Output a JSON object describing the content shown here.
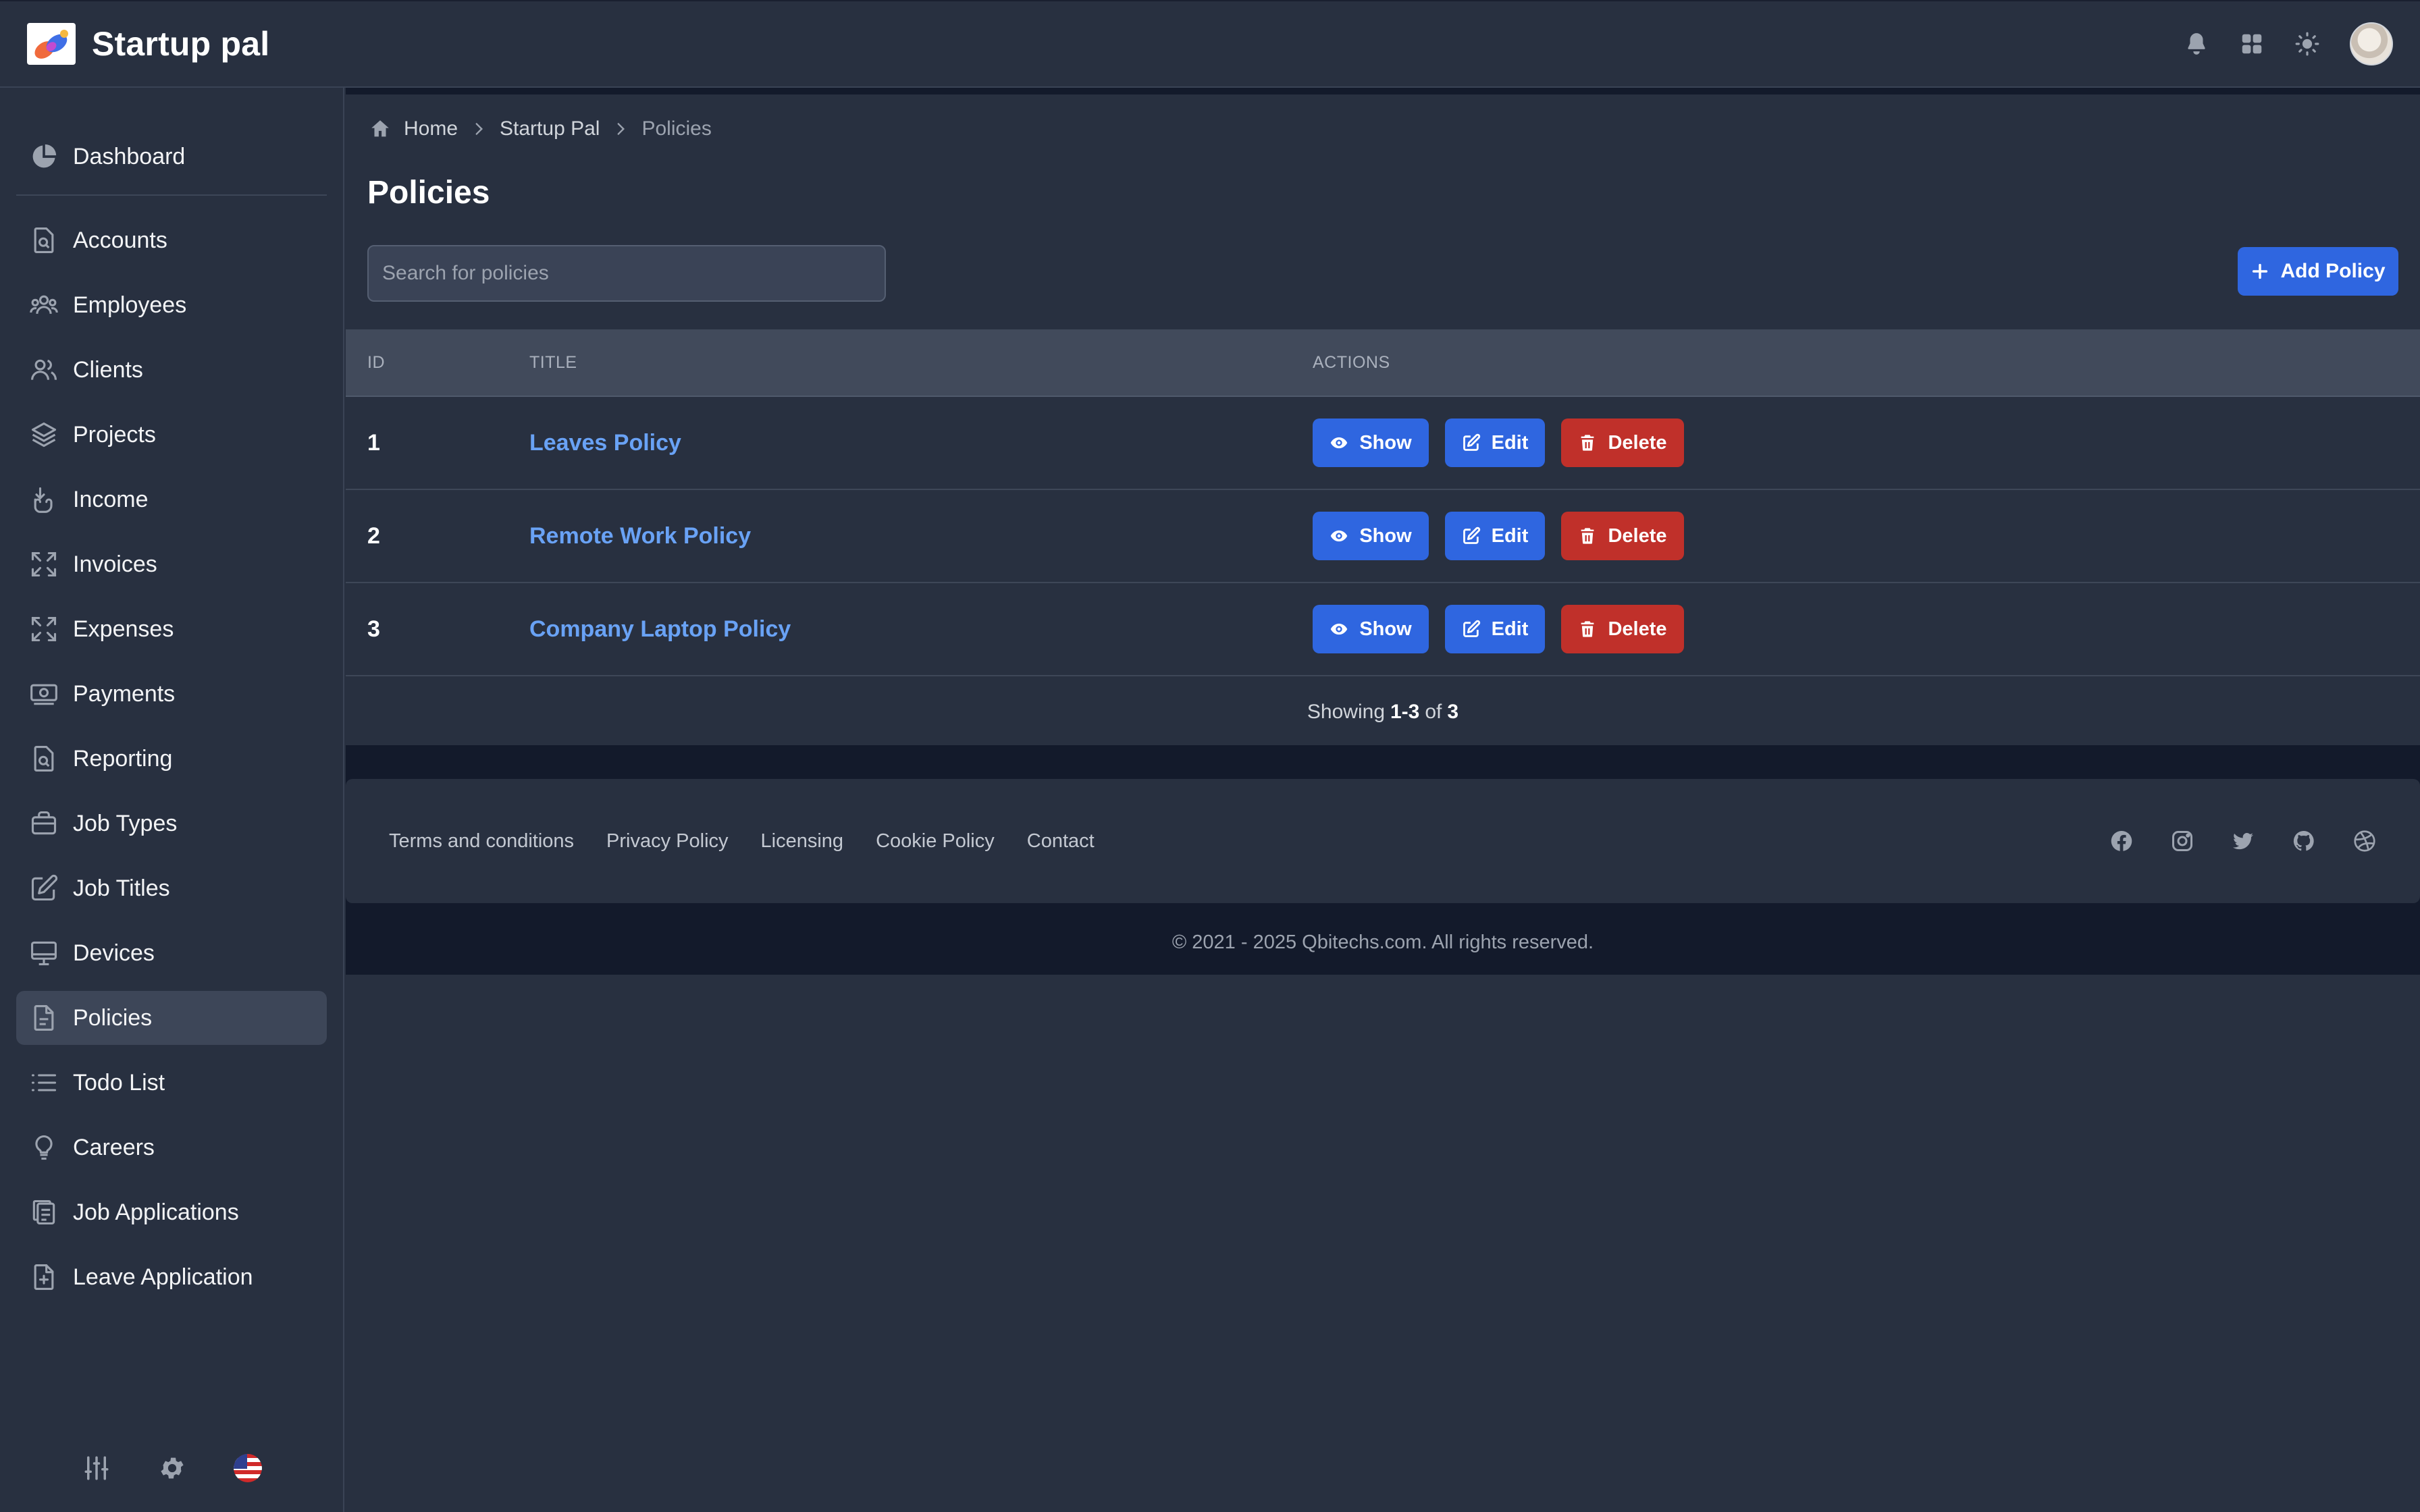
{
  "app": {
    "title": "Startup pal"
  },
  "header": {
    "icons": [
      "bell-icon",
      "apps-grid-icon",
      "sun-icon",
      "user-avatar"
    ]
  },
  "sidebar": {
    "items": [
      {
        "label": "Dashboard",
        "icon": "pie-chart-icon"
      },
      {
        "label": "Accounts",
        "icon": "document-search-icon"
      },
      {
        "label": "Employees",
        "icon": "users-group-icon"
      },
      {
        "label": "Clients",
        "icon": "users-icon"
      },
      {
        "label": "Projects",
        "icon": "layers-icon"
      },
      {
        "label": "Income",
        "icon": "hand-coin-icon"
      },
      {
        "label": "Invoices",
        "icon": "expand-icon"
      },
      {
        "label": "Expenses",
        "icon": "expand-icon"
      },
      {
        "label": "Payments",
        "icon": "cash-icon"
      },
      {
        "label": "Reporting",
        "icon": "document-search-icon"
      },
      {
        "label": "Job Types",
        "icon": "briefcase-icon"
      },
      {
        "label": "Job Titles",
        "icon": "pencil-square-icon"
      },
      {
        "label": "Devices",
        "icon": "desktop-icon"
      },
      {
        "label": "Policies",
        "icon": "document-text-icon"
      },
      {
        "label": "Todo List",
        "icon": "list-icon"
      },
      {
        "label": "Careers",
        "icon": "lightbulb-icon"
      },
      {
        "label": "Job Applications",
        "icon": "clipboard-copy-icon"
      },
      {
        "label": "Leave Application",
        "icon": "document-add-icon"
      }
    ],
    "active": "Policies",
    "footer_icons": [
      "sliders-icon",
      "gear-icon",
      "us-flag-icon"
    ]
  },
  "breadcrumb": {
    "home": "Home",
    "section": "Startup Pal",
    "current": "Policies"
  },
  "page": {
    "title": "Policies"
  },
  "search": {
    "placeholder": "Search for policies",
    "value": ""
  },
  "toolbar": {
    "add_label": "Add Policy"
  },
  "table": {
    "columns": [
      "ID",
      "TITLE",
      "ACTIONS"
    ],
    "rows": [
      {
        "id": "1",
        "title": "Leaves Policy"
      },
      {
        "id": "2",
        "title": "Remote Work Policy"
      },
      {
        "id": "3",
        "title": "Company Laptop Policy"
      }
    ],
    "actions": {
      "show": "Show",
      "edit": "Edit",
      "delete": "Delete"
    }
  },
  "pagination": {
    "prefix": "Showing",
    "range": "1-3",
    "of": "of",
    "total": "3"
  },
  "footer": {
    "links": [
      "Terms and conditions",
      "Privacy Policy",
      "Licensing",
      "Cookie Policy",
      "Contact"
    ],
    "socials": [
      "facebook-icon",
      "instagram-icon",
      "twitter-icon",
      "github-icon",
      "dribbble-icon"
    ],
    "copyright": "© 2021 - 2025 Qbitechs.com. All rights reserved."
  },
  "colors": {
    "background": "#283040",
    "primary": "#2f66e0",
    "danger": "#c0302a",
    "link": "#69a2f5"
  }
}
